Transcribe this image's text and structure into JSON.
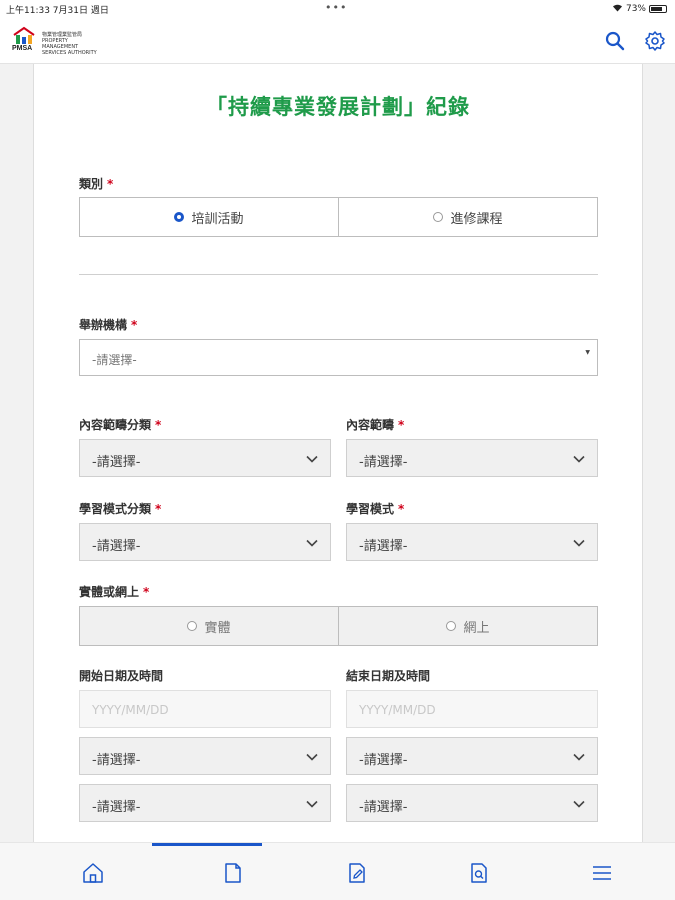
{
  "status_bar": {
    "time_date": "上午11:33   7月31日 週日",
    "dots": "•••",
    "battery": "73%"
  },
  "header": {
    "logo_abbr": "PMSA",
    "logo_org": "物業管理業監管局 PROPERTY MANAGEMENT SERVICES AUTHORITY",
    "icons": [
      "search-icon",
      "settings-icon"
    ],
    "accent": "#1a56c9"
  },
  "form": {
    "title": "「持續專業發展計劃」紀錄",
    "title_color": "#1f9b4a",
    "category": {
      "label": "類別",
      "options": [
        "培訓活動",
        "進修課程"
      ],
      "selected": "培訓活動"
    },
    "organizer": {
      "label": "舉辦機構",
      "placeholder": "-請選擇-"
    },
    "content_category": {
      "label": "內容範疇分類",
      "value": "-請選擇-"
    },
    "content_scope": {
      "label": "內容範疇",
      "value": "-請選擇-"
    },
    "mode_category": {
      "label": "學習模式分類",
      "value": "-請選擇-"
    },
    "mode": {
      "label": "學習模式",
      "value": "-請選擇-"
    },
    "physical_online": {
      "label": "實體或網上",
      "options": [
        "實體",
        "網上"
      ]
    },
    "start": {
      "label": "開始日期及時間",
      "date_placeholder": "YYYY/MM/DD",
      "select1": "-請選擇-",
      "select2": "-請選擇-"
    },
    "end": {
      "label": "結束日期及時間",
      "date_placeholder": "YYYY/MM/DD",
      "select1": "-請選擇-",
      "select2": "-請選擇-"
    },
    "required_mark": "*"
  },
  "bottom_nav": {
    "items": [
      "home-icon",
      "document-icon",
      "edit-document-icon",
      "search-document-icon",
      "menu-icon"
    ],
    "active_index": 1
  }
}
